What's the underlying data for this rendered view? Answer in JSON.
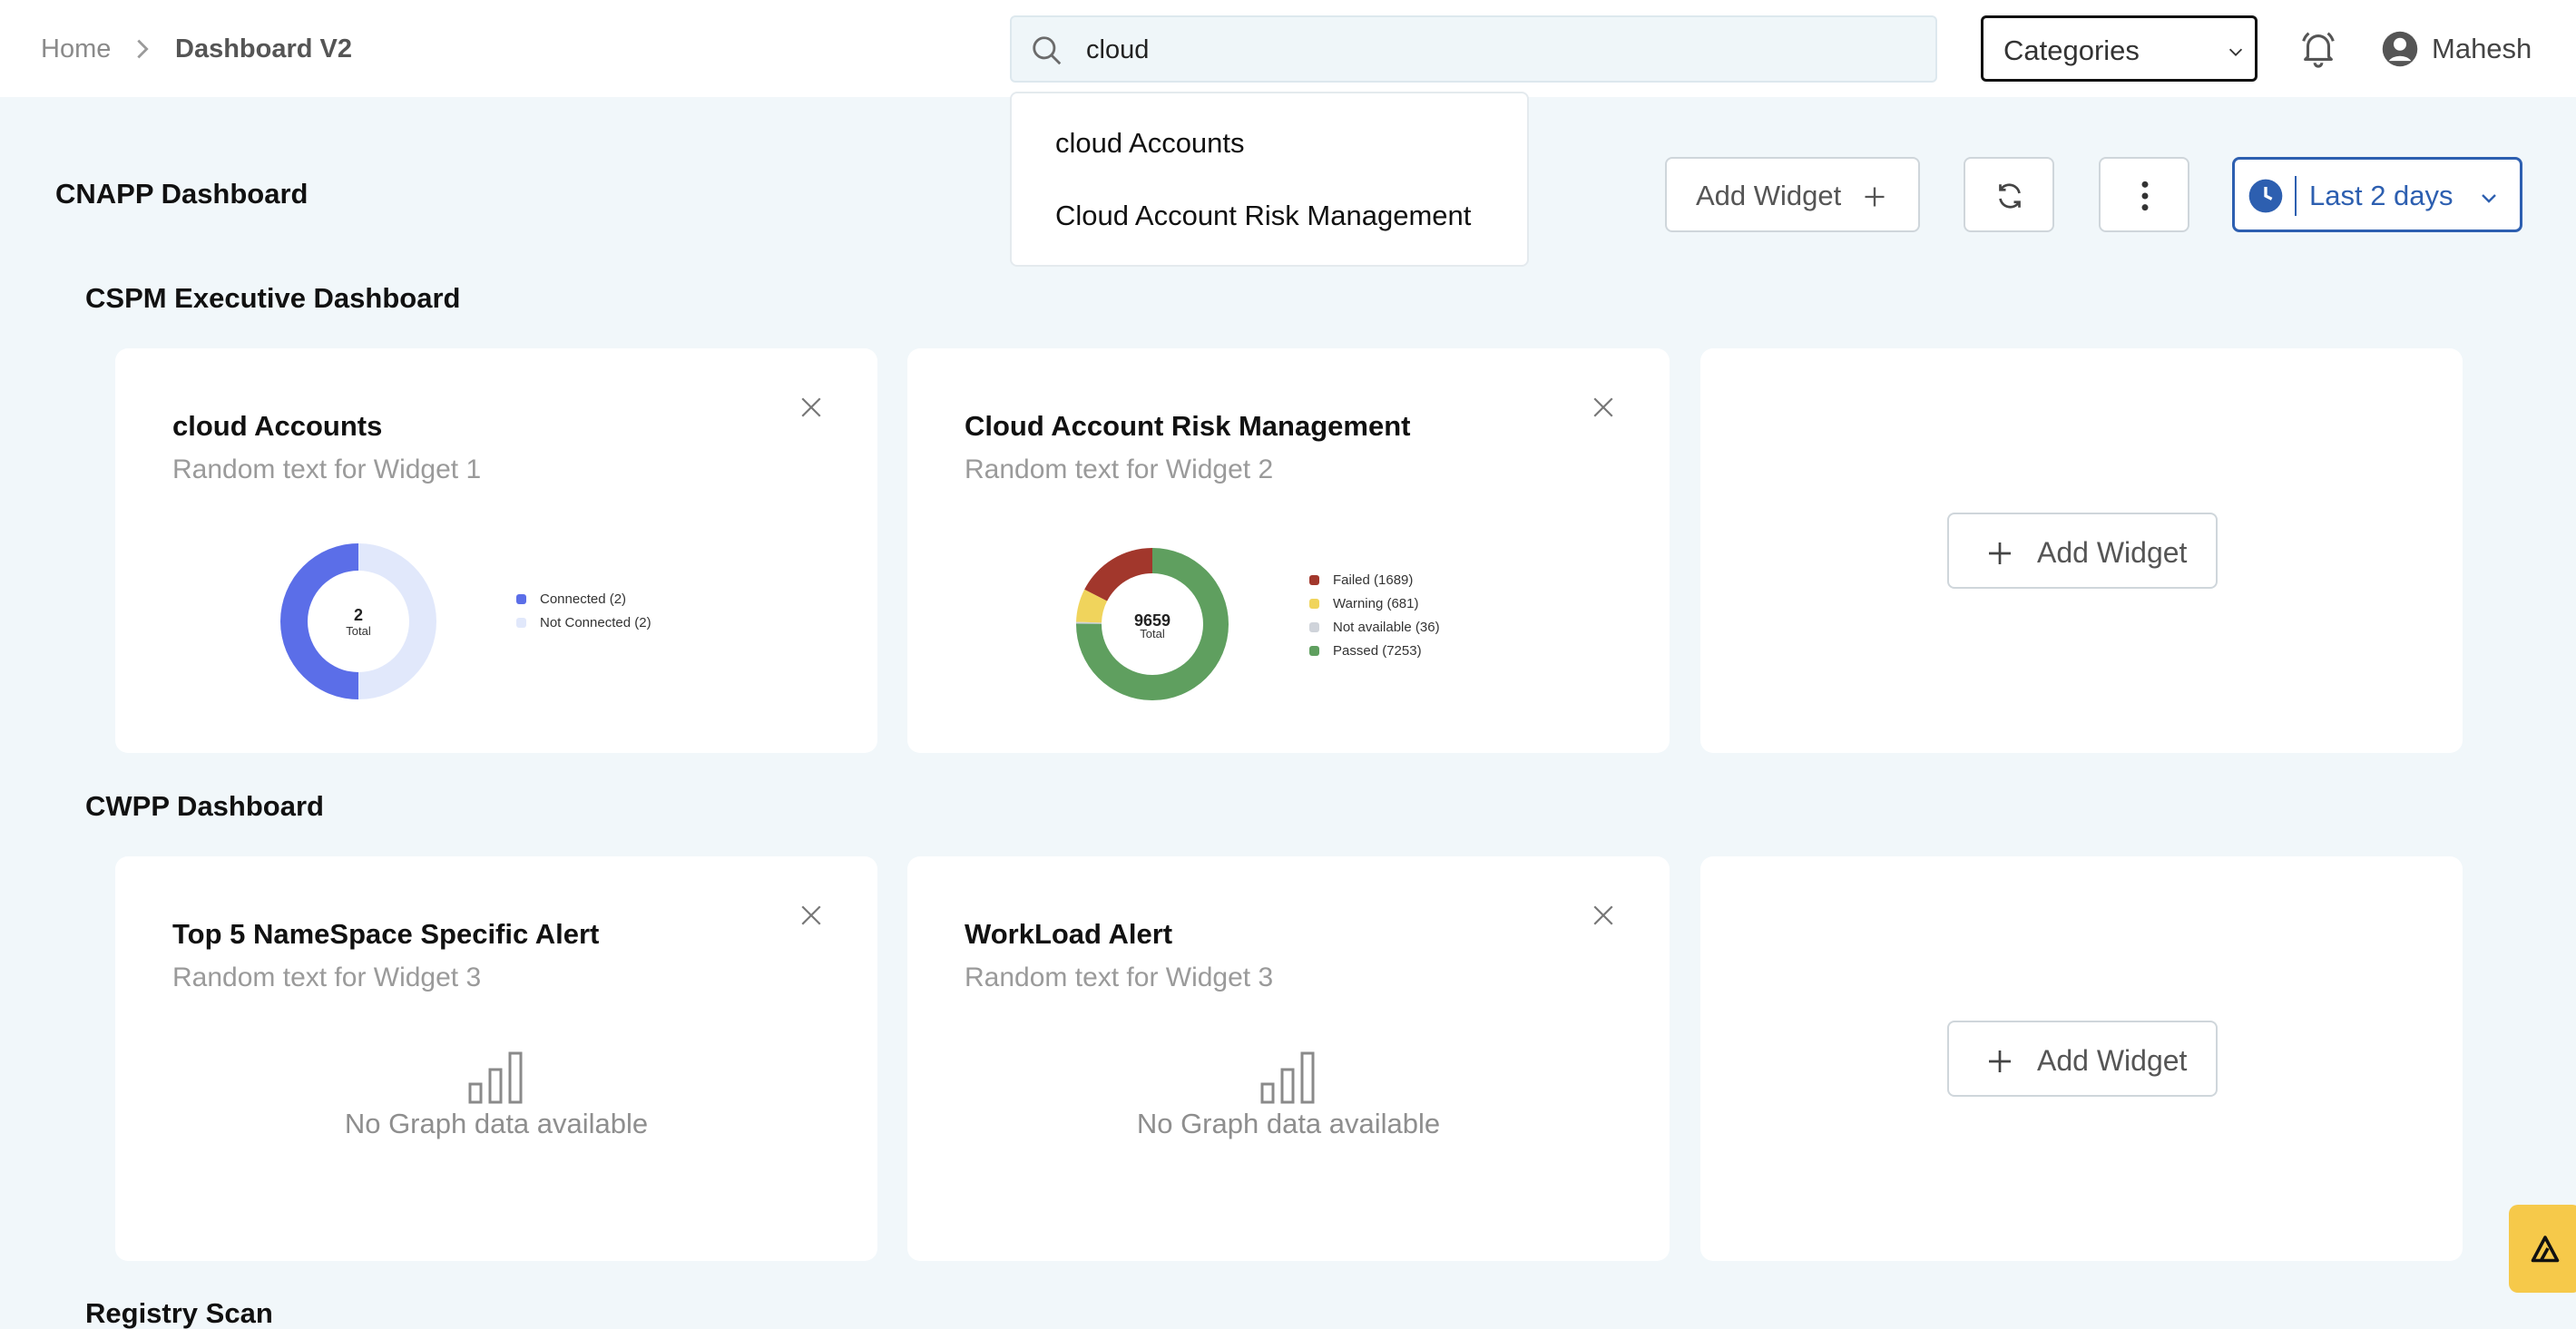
{
  "breadcrumb": {
    "home": "Home",
    "current": "Dashboard V2"
  },
  "search": {
    "value": "cloud",
    "suggestions": [
      "cloud Accounts",
      "Cloud Account Risk Management"
    ]
  },
  "categories": {
    "label": "Categories"
  },
  "user": {
    "name": "Mahesh"
  },
  "dashboard": {
    "title": "CNAPP Dashboard",
    "add_widget_label": "Add Widget",
    "time_range": "Last 2 days"
  },
  "sections": [
    {
      "title": "CSPM Executive Dashboard",
      "widgets": [
        {
          "title": "cloud Accounts",
          "subtitle": "Random text for Widget 1",
          "total": "2",
          "total_label": "Total",
          "legend": [
            "Connected (2)",
            "Not Connected (2)"
          ]
        },
        {
          "title": "Cloud Account Risk Management",
          "subtitle": "Random text for Widget 2",
          "total": "9659",
          "total_label": "Total",
          "legend": [
            "Failed (1689)",
            "Warning (681)",
            "Not available (36)",
            "Passed (7253)"
          ]
        }
      ],
      "add_widget_label": "Add Widget"
    },
    {
      "title": "CWPP Dashboard",
      "widgets": [
        {
          "title": "Top 5 NameSpace Specific Alert",
          "subtitle": "Random text for Widget 3",
          "empty_text": "No Graph data available"
        },
        {
          "title": "WorkLoad Alert",
          "subtitle": "Random text for Widget 3",
          "empty_text": "No Graph data available"
        }
      ],
      "add_widget_label": "Add Widget"
    },
    {
      "title": "Registry Scan"
    }
  ],
  "chart_data": [
    {
      "type": "pie",
      "categories": [
        "Connected",
        "Not Connected"
      ],
      "values": [
        2,
        2
      ],
      "colors": [
        "#5b6ee8",
        "#e1e8fb"
      ]
    },
    {
      "type": "pie",
      "categories": [
        "Failed",
        "Warning",
        "Not available",
        "Passed"
      ],
      "values": [
        1689,
        681,
        36,
        7253
      ],
      "colors": [
        "#a2372c",
        "#f0d45c",
        "#cfd3da",
        "#5f9f5f"
      ]
    }
  ],
  "icons": {
    "chevron_right": "chevron-right-icon",
    "search": "search-icon",
    "bell": "bell-icon",
    "user": "user-circle-icon",
    "refresh": "refresh-icon",
    "more": "more-vertical-icon",
    "clock": "clock-icon",
    "close": "close-icon",
    "plus": "plus-icon",
    "bar_chart": "bar-chart-icon"
  },
  "colors": {
    "accent": "#2d5fb0",
    "page_bg": "#f1f7fa",
    "helper": "#f6c94a"
  }
}
